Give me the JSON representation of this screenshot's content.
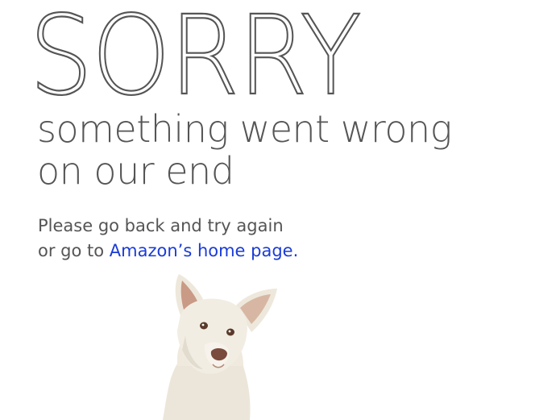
{
  "error_page": {
    "headline": "SORRY",
    "subtitle_line1": "something went wrong",
    "subtitle_line2": "on our end",
    "message_line1": "Please go back and try again",
    "message_line2_prefix": "or go to ",
    "home_link_text": "Amazon’s home page."
  },
  "colors": {
    "text": "#555555",
    "link": "#1a3cd6",
    "background": "#ffffff"
  },
  "images": {
    "dog": "dog-illustration"
  }
}
